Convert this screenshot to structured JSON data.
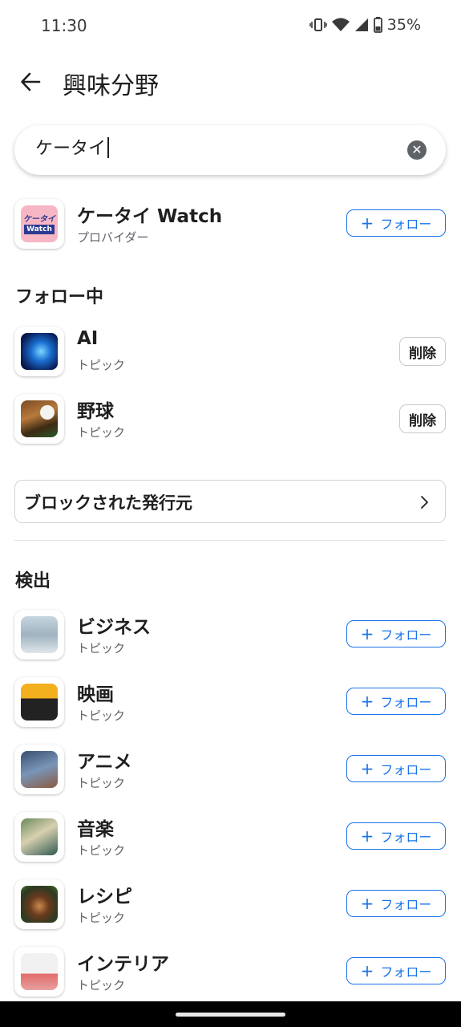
{
  "status_bar": {
    "time": "11:30",
    "battery": "35%"
  },
  "header": {
    "title": "興味分野"
  },
  "search": {
    "value": "ケータイ"
  },
  "provider_result": {
    "title": "ケータイ Watch",
    "subtitle": "プロバイダー",
    "follow_label": "フォロー",
    "logo_top": "ケータイ",
    "logo_bottom": "Watch"
  },
  "following": {
    "heading": "フォロー中",
    "items": [
      {
        "title": "AI",
        "subtitle": "トピック",
        "action": "削除"
      },
      {
        "title": "野球",
        "subtitle": "トピック",
        "action": "削除"
      }
    ]
  },
  "blocked": {
    "label": "ブロックされた発行元"
  },
  "discover": {
    "heading": "検出",
    "items": [
      {
        "title": "ビジネス",
        "subtitle": "トピック",
        "action": "フォロー"
      },
      {
        "title": "映画",
        "subtitle": "トピック",
        "action": "フォロー"
      },
      {
        "title": "アニメ",
        "subtitle": "トピック",
        "action": "フォロー"
      },
      {
        "title": "音楽",
        "subtitle": "トピック",
        "action": "フォロー"
      },
      {
        "title": "レシピ",
        "subtitle": "トピック",
        "action": "フォロー"
      },
      {
        "title": "インテリア",
        "subtitle": "トピック",
        "action": "フォロー"
      }
    ]
  },
  "colors": {
    "accent": "#1a73e8",
    "text": "#1f1f1f",
    "secondary": "#5f6368"
  },
  "icons": {
    "back": "arrow-back-icon",
    "clear": "clear-icon",
    "chevron": "chevron-right-icon",
    "vibrate": "vibrate-icon",
    "wifi": "wifi-icon",
    "signal": "signal-icon",
    "battery": "battery-icon"
  }
}
